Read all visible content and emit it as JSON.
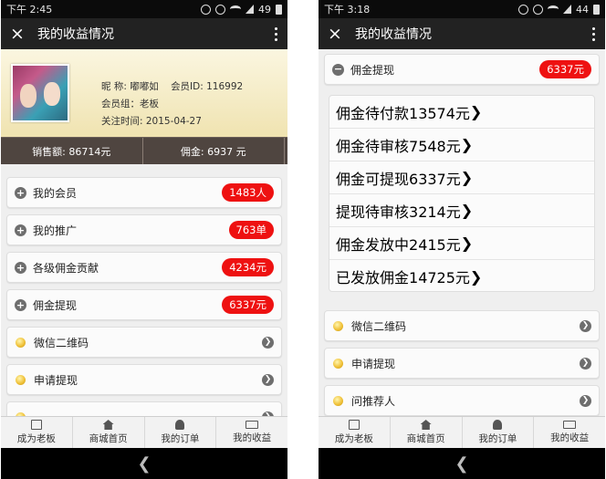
{
  "left": {
    "status": {
      "time": "下午 2:45",
      "battery": "49"
    },
    "title": "我的收益情况",
    "profile": {
      "nickname": "昵 称: 嘟嘟如",
      "member_id": "会员ID: 116992",
      "group": "会员组：老板",
      "follow_time": "关注时间: 2015-04-27"
    },
    "stats": {
      "sales": "销售额: 86714元",
      "commission": "佣金: 6937 元"
    },
    "items": [
      {
        "label": "我的会员",
        "badge": "1483人"
      },
      {
        "label": "我的推广",
        "badge": "763单"
      },
      {
        "label": "各级佣金贡献",
        "badge": "4234元"
      },
      {
        "label": "佣金提现",
        "badge": "6337元"
      },
      {
        "label": "微信二维码"
      },
      {
        "label": "申请提现"
      }
    ],
    "nav": [
      "成为老板",
      "商城首页",
      "我的订单",
      "我的收益"
    ]
  },
  "right": {
    "status": {
      "time": "下午 3:18",
      "battery": "44"
    },
    "title": "我的收益情况",
    "header_item": {
      "label": "佣金提现",
      "badge": "6337元"
    },
    "group": [
      {
        "label": "佣金待付款",
        "value": "13574元"
      },
      {
        "label": "佣金待审核",
        "value": "7548元"
      },
      {
        "label": "佣金可提现",
        "value": "6337元"
      },
      {
        "label": "提现待审核",
        "value": "3214元"
      },
      {
        "label": "佣金发放中",
        "value": "2415元"
      },
      {
        "label": "已发放佣金",
        "value": "14725元"
      }
    ],
    "items": [
      {
        "label": "微信二维码"
      },
      {
        "label": "申请提现"
      },
      {
        "label": "问推荐人"
      }
    ],
    "nav": [
      "成为老板",
      "商城首页",
      "我的订单",
      "我的收益"
    ]
  },
  "icons": {
    "close": "×",
    "plus": "+",
    "minus": "−",
    "arrow": "❯",
    "back": "❮"
  }
}
